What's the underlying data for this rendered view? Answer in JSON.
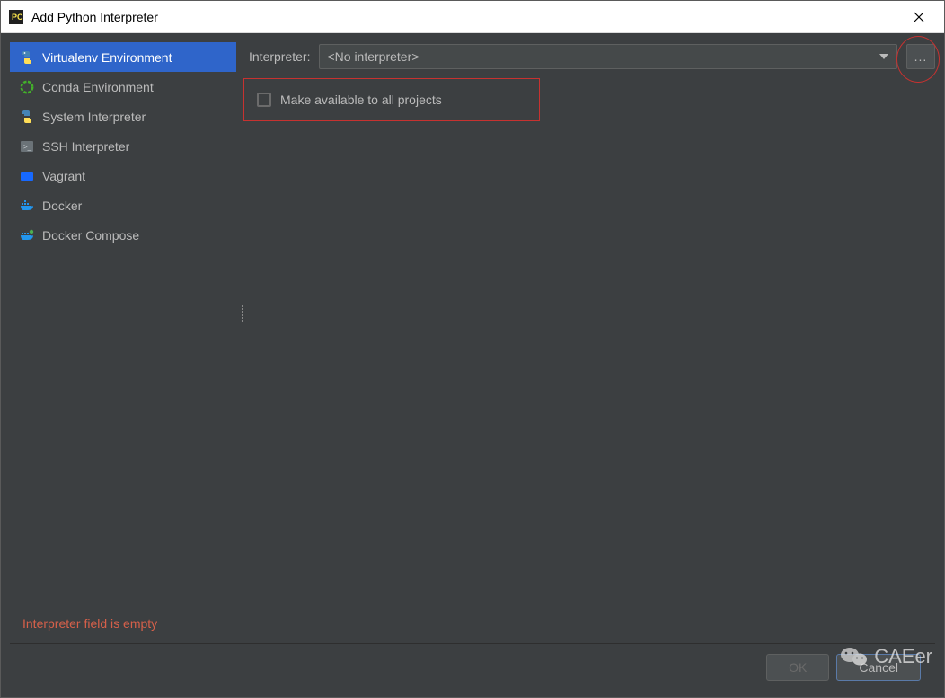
{
  "window": {
    "title": "Add Python Interpreter"
  },
  "sidebar": {
    "items": [
      {
        "label": "Virtualenv Environment",
        "icon": "python-venv-icon",
        "selected": true
      },
      {
        "label": "Conda Environment",
        "icon": "conda-icon",
        "selected": false
      },
      {
        "label": "System Interpreter",
        "icon": "python-icon",
        "selected": false
      },
      {
        "label": "SSH Interpreter",
        "icon": "terminal-icon",
        "selected": false
      },
      {
        "label": "Vagrant",
        "icon": "vagrant-icon",
        "selected": false
      },
      {
        "label": "Docker",
        "icon": "docker-icon",
        "selected": false
      },
      {
        "label": "Docker Compose",
        "icon": "docker-compose-icon",
        "selected": false
      }
    ]
  },
  "main": {
    "interpreter_label": "Interpreter:",
    "interpreter_value": "<No interpreter>",
    "browse_label": "...",
    "checkbox_label": "Make available to all projects",
    "checkbox_checked": false
  },
  "error": {
    "message": "Interpreter field is empty"
  },
  "buttons": {
    "ok": "OK",
    "cancel": "Cancel"
  },
  "watermark": {
    "text": "CAEer"
  }
}
